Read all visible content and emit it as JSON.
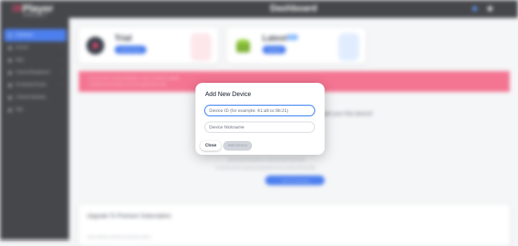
{
  "app": {
    "logo_prefix": "IX",
    "logo_name": "Player",
    "logo_sub": "PROJECT",
    "page_title": "Dashboard"
  },
  "sidebar": {
    "items": [
      {
        "label": "Dashboard",
        "active": true,
        "has_children": false
      },
      {
        "label": "Account",
        "active": false,
        "has_children": true
      },
      {
        "label": "Apps",
        "active": false,
        "has_children": true
      },
      {
        "label": "Channel Management",
        "active": false,
        "has_children": true
      },
      {
        "label": "Pin Android Presets",
        "active": false,
        "has_children": true
      },
      {
        "label": "Contents Reporting",
        "active": false,
        "has_children": false
      },
      {
        "label": "FAQ",
        "active": false,
        "has_children": false
      }
    ]
  },
  "cards": [
    {
      "title": "Trial",
      "button": "Add New Device",
      "badge": ""
    },
    {
      "title": "Latest",
      "button": "Download",
      "badge": "Info"
    }
  ],
  "alert": {
    "line1": "You do not have a Premium subscription, so only 1 connection is available.",
    "line2": "To upgrade your subscription, click on the upgrade button below."
  },
  "main": {
    "empty_message": "add your first device!",
    "sub_line1": "Add your device by clicking on \"Add New Device\" button above.",
    "sub_line2": "You can also check our quick and simple guide on how to add your devices easily.",
    "cta_label": "+ Add Your First Device"
  },
  "upgrade": {
    "title": "Upgrade To Premium Subscription",
    "text": "Unlock unlimited connections and premium features."
  },
  "modal": {
    "title": "Add New Device",
    "device_id_placeholder": "Device ID (for example: 61:a8:cc:9b:21)",
    "nickname_placeholder": "Device Nickname",
    "close_label": "Close",
    "add_label": "Add Device"
  },
  "colors": {
    "accent": "#2563eb",
    "alert": "#f2577a",
    "sidebar": "#1e1f23"
  }
}
